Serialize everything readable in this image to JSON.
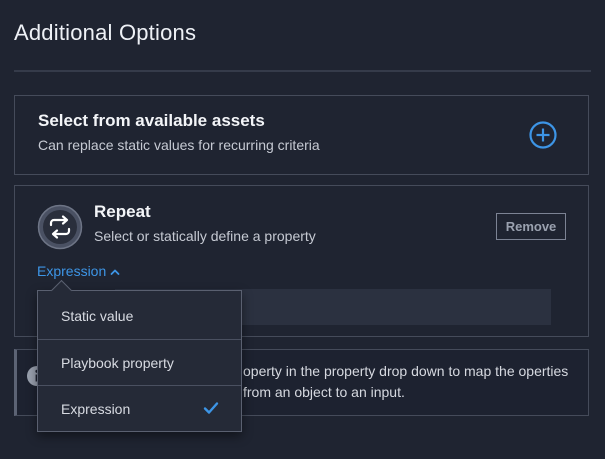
{
  "title": "Additional Options",
  "assets_card": {
    "heading": "Select from available assets",
    "subtitle": "Can replace static values for recurring criteria",
    "add_icon": "plus-circle-icon"
  },
  "repeat_card": {
    "icon": "repeat-arrows-icon",
    "title": "Repeat",
    "subtitle": "Select or statically define a property",
    "remove_label": "Remove",
    "mode_label": "Expression",
    "mode_icon": "chevron-up-icon"
  },
  "info_card": {
    "icon": "info-icon",
    "text": "operty in the property drop down to map the operties from an object to an input."
  },
  "dropdown": {
    "options": [
      {
        "label": "Static value",
        "selected": false
      },
      {
        "label": "Playbook property",
        "selected": false
      },
      {
        "label": "Expression",
        "selected": true
      }
    ],
    "check_icon": "checkmark-icon"
  },
  "colors": {
    "background": "#1f2431",
    "accent": "#3d95e6",
    "border": "#454b5a"
  }
}
